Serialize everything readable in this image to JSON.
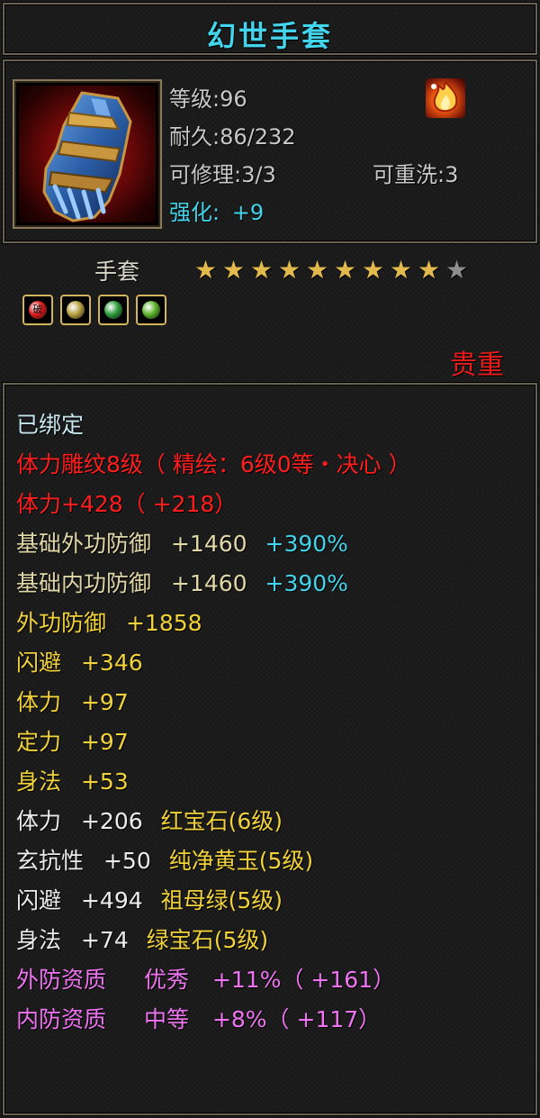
{
  "item": {
    "name": "幻世手套",
    "level": "等级:96",
    "durability": "耐久:86/232",
    "repair": "可修理:3/3",
    "rewash": "可重洗:3",
    "enhance_label": "强化:",
    "enhance_value": "+9",
    "type": "手套",
    "stars_filled": 9,
    "stars_total": 10,
    "rarity": "贵重",
    "portrait_icon": "gauntlet-icon",
    "effect_icon": "flame-buff-icon"
  },
  "sockets": [
    {
      "icon": "red-gem-icon",
      "color": "#d81818",
      "glyph": "破"
    },
    {
      "icon": "yellow-jade-icon",
      "color": "#b8a040",
      "glyph": ""
    },
    {
      "icon": "emerald-icon",
      "color": "#2a9a3a",
      "glyph": ""
    },
    {
      "icon": "green-gem-icon",
      "color": "#5ab028",
      "glyph": ""
    }
  ],
  "stats": {
    "bound": "已绑定",
    "engrave": "体力雕纹8级（ 精绘：6级0等・决心 ）",
    "engrave_bonus": "体力+428（ +218）",
    "base_ext_def": {
      "name": "基础外功防御",
      "value": "+1460",
      "pct": "+390%"
    },
    "base_int_def": {
      "name": "基础内功防御",
      "value": "+1460",
      "pct": "+390%"
    },
    "ext_def": {
      "name": "外功防御",
      "value": "+1858"
    },
    "dodge": {
      "name": "闪避",
      "value": "+346"
    },
    "stamina": {
      "name": "体力",
      "value": "+97"
    },
    "focus": {
      "name": "定力",
      "value": "+97"
    },
    "agility": {
      "name": "身法",
      "value": "+53"
    },
    "gem_lines": [
      {
        "name": "体力",
        "value": "+206",
        "gem": "红宝石(6级)"
      },
      {
        "name": "玄抗性",
        "value": "+50",
        "gem": "纯净黄玉(5级)"
      },
      {
        "name": "闪避",
        "value": "+494",
        "gem": "祖母绿(5级)"
      },
      {
        "name": "身法",
        "value": "+74",
        "gem": "绿宝石(5级)"
      }
    ],
    "quality_lines": [
      {
        "name": "外防资质",
        "grade": "优秀",
        "bonus": "+11%（ +161）"
      },
      {
        "name": "内防资质",
        "grade": "中等",
        "bonus": "+8%（ +117）"
      }
    ]
  },
  "colors": {
    "title": "#43d3ea",
    "rarity": "#e81b1b",
    "engrave": "#ff1e1e",
    "gem_stat": "#f1d23a",
    "quality": "#ef74f2"
  }
}
